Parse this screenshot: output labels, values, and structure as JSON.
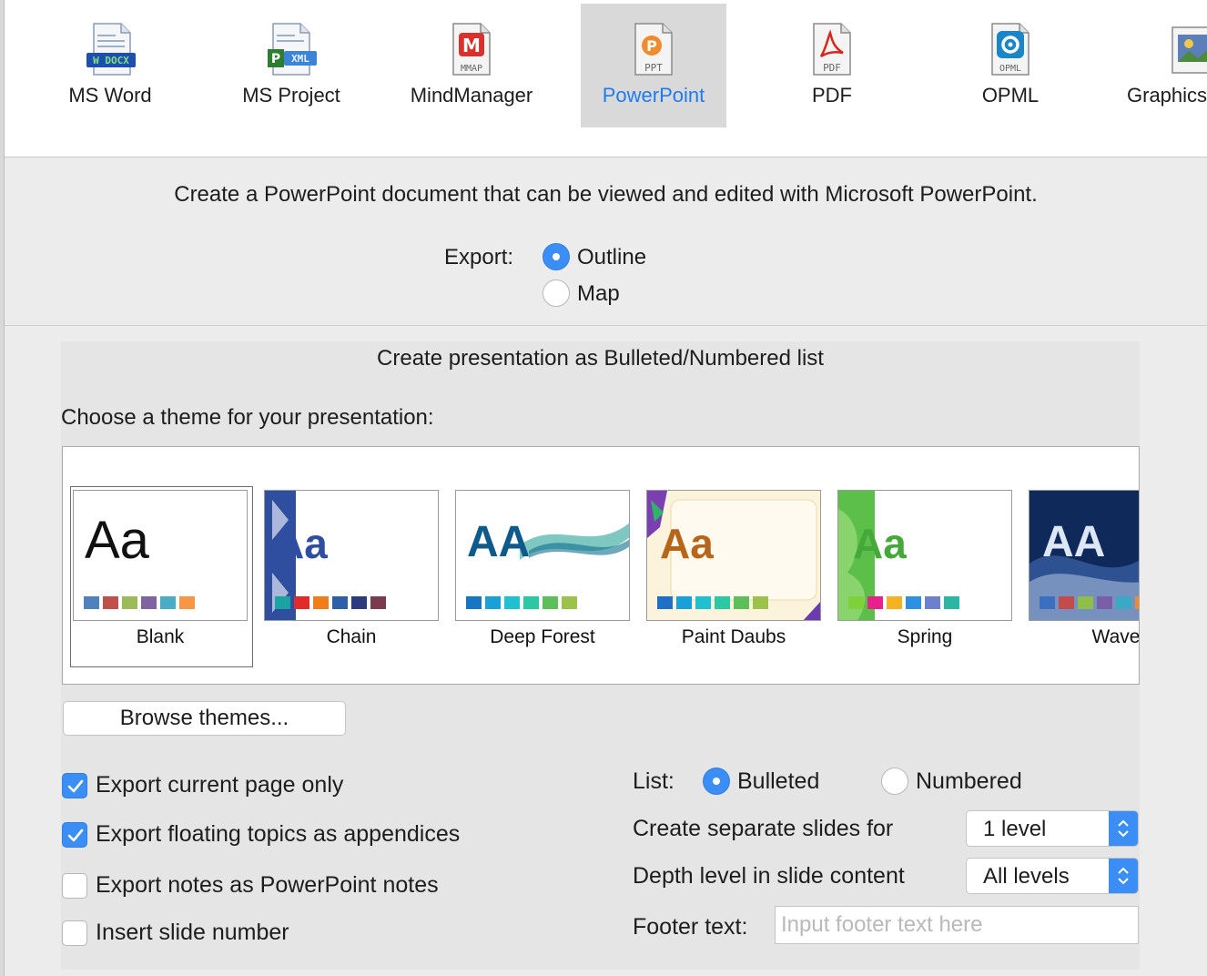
{
  "toolbar": {
    "items": [
      {
        "label": "MS Word",
        "icon": "docx-icon",
        "badge": "DOCX"
      },
      {
        "label": "MS Project",
        "icon": "xml-icon",
        "badge": "XML"
      },
      {
        "label": "MindManager",
        "icon": "mmap-icon",
        "badge": "MMAP"
      },
      {
        "label": "PowerPoint",
        "icon": "ppt-icon",
        "badge": "PPT"
      },
      {
        "label": "PDF",
        "icon": "pdf-icon",
        "badge": "PDF"
      },
      {
        "label": "OPML",
        "icon": "opml-icon",
        "badge": "OPML"
      },
      {
        "label": "Graphics",
        "icon": "graphics-icon",
        "badge": ""
      }
    ],
    "selected": "PowerPoint"
  },
  "description": "Create a PowerPoint document that can be viewed and edited with Microsoft PowerPoint.",
  "export": {
    "label": "Export:",
    "options": [
      "Outline",
      "Map"
    ],
    "selected": "Outline"
  },
  "panel": {
    "title": "Create presentation as Bulleted/Numbered list",
    "theme_prompt": "Choose a theme for your presentation:",
    "themes": [
      {
        "name": "Blank",
        "sample": "Aa"
      },
      {
        "name": "Chain",
        "sample": "Aa"
      },
      {
        "name": "Deep Forest",
        "sample": "AA"
      },
      {
        "name": "Paint Daubs",
        "sample": "Aa"
      },
      {
        "name": "Spring",
        "sample": "Aa"
      },
      {
        "name": "Wave",
        "sample": "AA"
      }
    ],
    "selected_theme": "Blank",
    "browse_label": "Browse themes..."
  },
  "options": {
    "export_current_page": {
      "label": "Export current page only",
      "checked": true
    },
    "export_floating": {
      "label": "Export floating topics as appendices",
      "checked": true
    },
    "export_notes": {
      "label": "Export notes as PowerPoint notes",
      "checked": false
    },
    "insert_slide_number": {
      "label": "Insert slide number",
      "checked": false
    }
  },
  "list": {
    "label": "List:",
    "options": [
      "Bulleted",
      "Numbered"
    ],
    "selected": "Bulleted"
  },
  "separate_slides": {
    "label": "Create separate slides for",
    "value": "1 level"
  },
  "depth_level": {
    "label": "Depth level in slide content",
    "value": "All levels"
  },
  "footer": {
    "label": "Footer text:",
    "placeholder": "Input footer text here",
    "value": ""
  },
  "colors": {
    "accent": "#3b8ef6",
    "selected_text": "#1e7cf0"
  }
}
